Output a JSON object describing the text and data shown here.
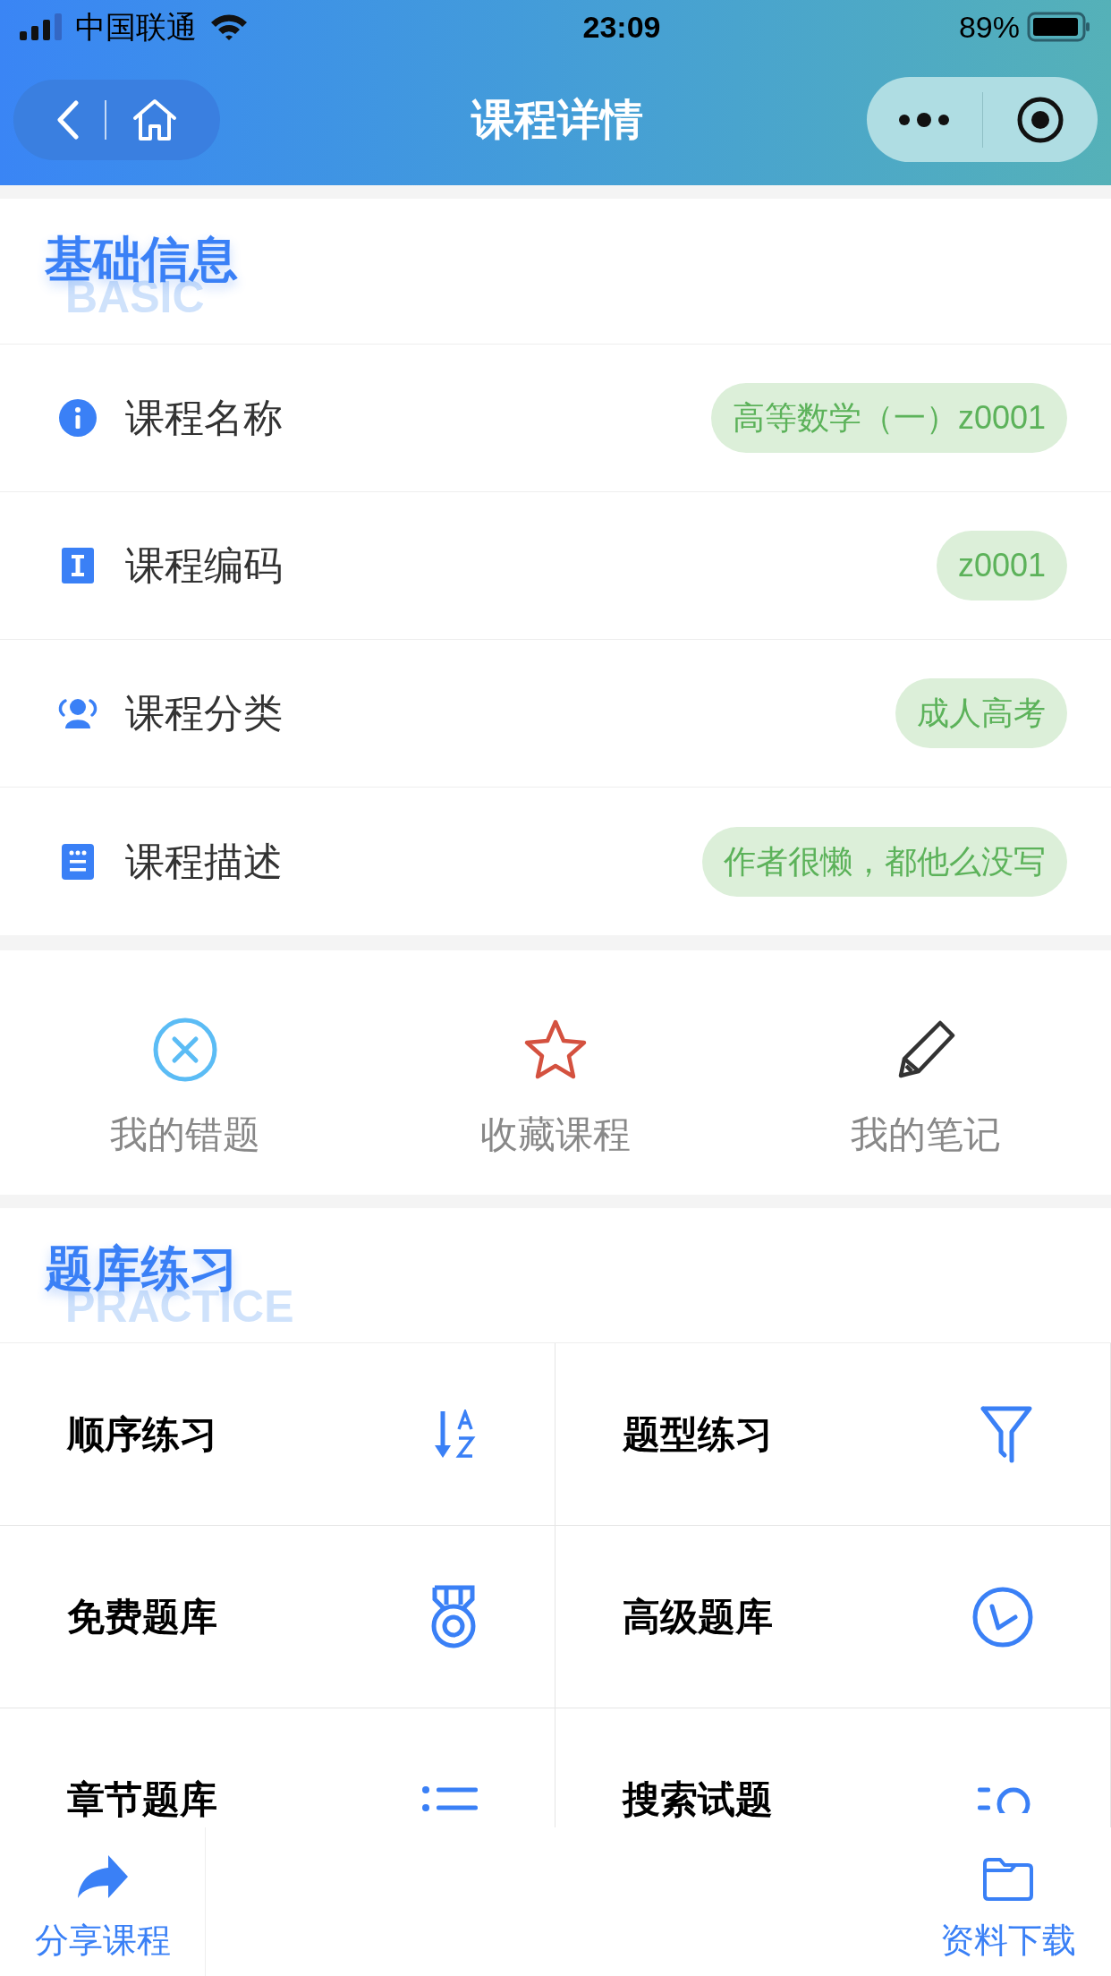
{
  "status_bar": {
    "carrier": "中国联通",
    "time": "23:09",
    "battery": "89%"
  },
  "nav": {
    "title": "课程详情"
  },
  "basic": {
    "title": "基础信息",
    "subtitle": "BASIC"
  },
  "info_rows": [
    {
      "label": "课程名称",
      "value": "高等数学（一）z0001"
    },
    {
      "label": "课程编码",
      "value": "z0001"
    },
    {
      "label": "课程分类",
      "value": "成人高考"
    },
    {
      "label": "课程描述",
      "value": "作者很懒，都他么没写"
    }
  ],
  "actions": [
    {
      "label": "我的错题"
    },
    {
      "label": "收藏课程"
    },
    {
      "label": "我的笔记"
    }
  ],
  "practice": {
    "title": "题库练习",
    "subtitle": "PRACTICE"
  },
  "practice_items": [
    {
      "label": "顺序练习"
    },
    {
      "label": "题型练习"
    },
    {
      "label": "免费题库"
    },
    {
      "label": "高级题库"
    },
    {
      "label": "章节题库"
    },
    {
      "label": "搜索试题"
    }
  ],
  "bottom_bar": [
    {
      "label": "分享课程"
    },
    {
      "label": "资料下载"
    }
  ]
}
